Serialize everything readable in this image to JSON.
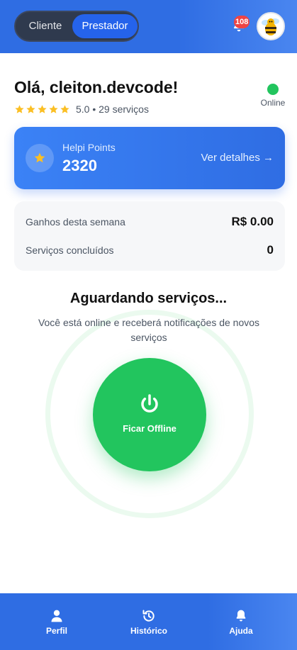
{
  "header": {
    "modes": {
      "client": "Cliente",
      "provider": "Prestador",
      "active": "provider"
    },
    "notifications_count": "108",
    "avatar_icon": "bee-avatar"
  },
  "greeting": {
    "title": "Olá, cleiton.devcode!",
    "rating_stars": 5,
    "rating_text": "5.0 • 29 serviços"
  },
  "status": {
    "label": "Online",
    "color": "#22c55e"
  },
  "points": {
    "label": "Helpi Points",
    "value": "2320",
    "link": "Ver detalhes →",
    "icon": "star-icon"
  },
  "stats": {
    "earnings_label": "Ganhos desta semana",
    "earnings_value": "R$ 0.00",
    "completed_label": "Serviços concluídos",
    "completed_value": "0"
  },
  "waiting": {
    "title": "Aguardando serviços...",
    "description": "Você está online e receberá notificações de novos serviços",
    "button_label": "Ficar Offline",
    "button_icon": "power-icon"
  },
  "nav": {
    "items": [
      {
        "label": "Perfil",
        "icon": "user-icon"
      },
      {
        "label": "Histórico",
        "icon": "history-icon"
      },
      {
        "label": "Ajuda",
        "icon": "bell-icon"
      }
    ]
  },
  "colors": {
    "primary": "#2f6de3",
    "success": "#22c55e",
    "badge": "#ef4444",
    "star": "#fbbf24"
  }
}
